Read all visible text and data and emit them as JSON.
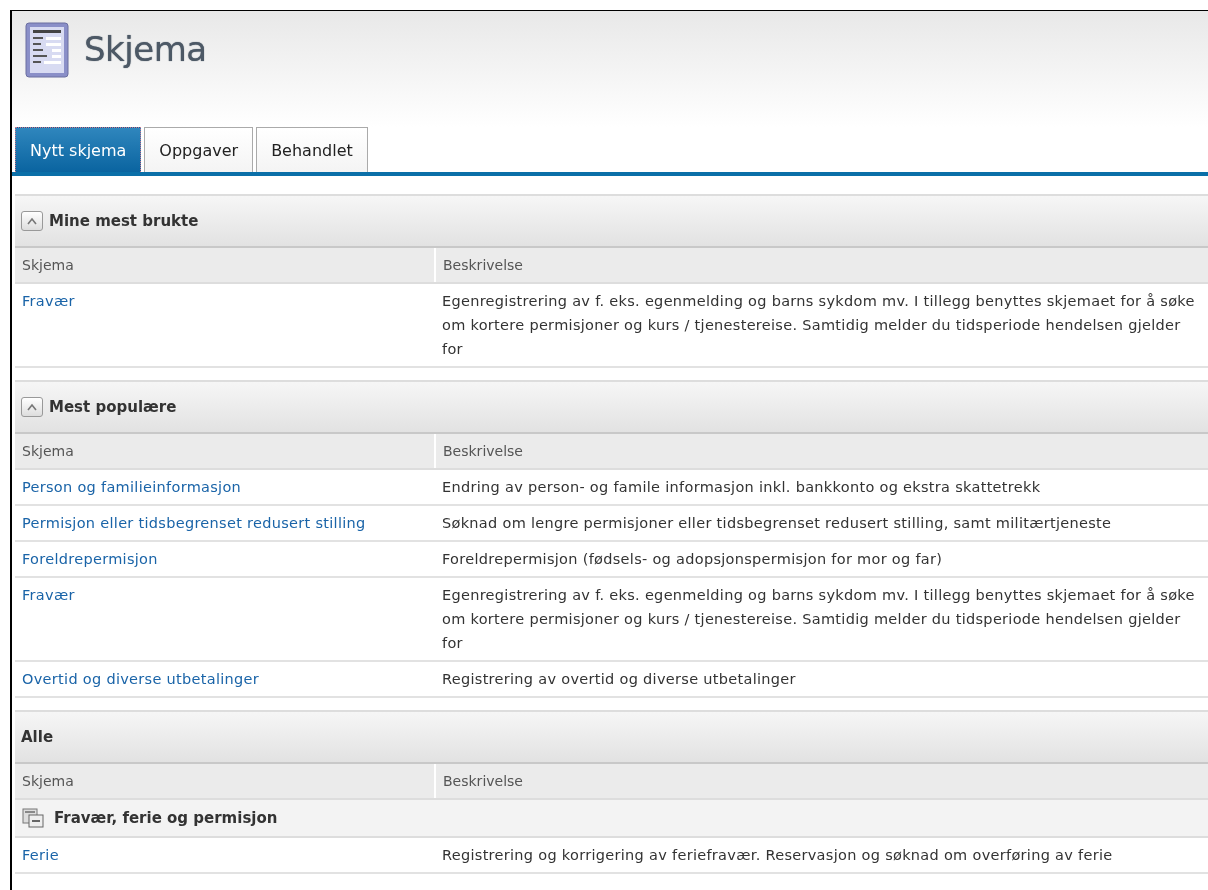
{
  "page": {
    "title": "Skjema"
  },
  "tabs": [
    {
      "label": "Nytt skjema",
      "selected": true
    },
    {
      "label": "Oppgaver",
      "selected": false
    },
    {
      "label": "Behandlet",
      "selected": false
    }
  ],
  "sections": [
    {
      "title": "Mine mest brukte",
      "kind": "collapsible",
      "expanded": true,
      "columns": [
        "Skjema",
        "Beskrivelse"
      ],
      "rows": [
        {
          "kind": "item",
          "name": "Fravær",
          "description": "Egenregistrering av f. eks. egenmelding og barns sykdom mv. I tillegg benyttes skjemaet for å søke om kortere permisjoner og kurs / tjenestereise. Samtidig melder du tidsperiode hendelsen gjelder for"
        }
      ]
    },
    {
      "title": "Mest populære",
      "kind": "collapsible",
      "expanded": true,
      "columns": [
        "Skjema",
        "Beskrivelse"
      ],
      "rows": [
        {
          "kind": "item",
          "name": "Person og familieinformasjon",
          "description": "Endring av person- og famile informasjon inkl. bankkonto og ekstra skattetrekk"
        },
        {
          "kind": "item",
          "name": "Permisjon eller tidsbegrenset redusert stilling",
          "description": "Søknad om lengre permisjoner eller tidsbegrenset redusert stilling, samt militærtjeneste"
        },
        {
          "kind": "item",
          "name": "Foreldrepermisjon",
          "description": "Foreldrepermisjon (fødsels- og adopsjonspermisjon for mor og far)"
        },
        {
          "kind": "item",
          "name": "Fravær",
          "description": "Egenregistrering av f. eks. egenmelding og barns sykdom mv. I tillegg benyttes skjemaet for å søke om kortere permisjoner og kurs / tjenestereise. Samtidig melder du tidsperiode hendelsen gjelder for"
        },
        {
          "kind": "item",
          "name": "Overtid og diverse utbetalinger",
          "description": "Registrering av overtid og diverse utbetalinger"
        }
      ]
    },
    {
      "title": "Alle",
      "kind": "plain",
      "columns": [
        "Skjema",
        "Beskrivelse"
      ],
      "rows": [
        {
          "kind": "group",
          "name": "Fravær, ferie og permisjon"
        },
        {
          "kind": "item",
          "name": "Ferie",
          "description": "Registrering og korrigering av feriefravær. Reservasjon og søknad om overføring av ferie"
        }
      ]
    }
  ]
}
